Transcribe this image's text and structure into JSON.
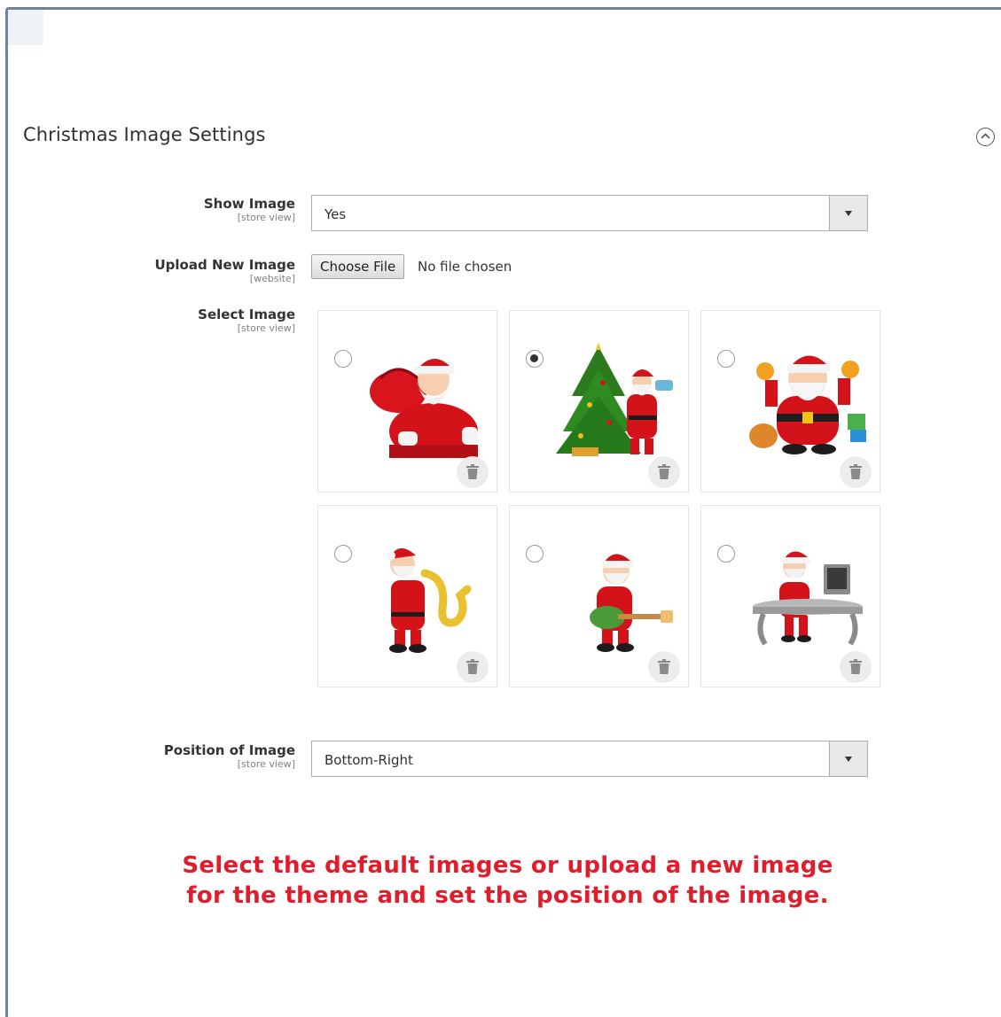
{
  "section": {
    "title": "Christmas Image Settings",
    "toggle_icon": "chevron-up-circle-icon"
  },
  "fields": {
    "show_image": {
      "label": "Show Image",
      "scope": "[store view]",
      "value": "Yes"
    },
    "upload_image": {
      "label": "Upload New Image",
      "scope": "[website]",
      "button": "Choose File",
      "status": "No file chosen"
    },
    "select_image": {
      "label": "Select Image",
      "scope": "[store view]",
      "options": [
        {
          "name": "santa-with-sack",
          "selected": false
        },
        {
          "name": "santa-with-christmas-tree",
          "selected": true
        },
        {
          "name": "cartoon-santa-with-gifts",
          "selected": false
        },
        {
          "name": "santa-playing-saxophone",
          "selected": false
        },
        {
          "name": "santa-playing-guitar",
          "selected": false
        },
        {
          "name": "santa-at-computer-desk",
          "selected": false
        }
      ]
    },
    "position": {
      "label": "Position of Image",
      "scope": "[store view]",
      "value": "Bottom-Right"
    }
  },
  "note": {
    "line1": "Select the default images or upload a new image",
    "line2": "for the theme and set the position of the image.",
    "color": "#e21d2b"
  }
}
